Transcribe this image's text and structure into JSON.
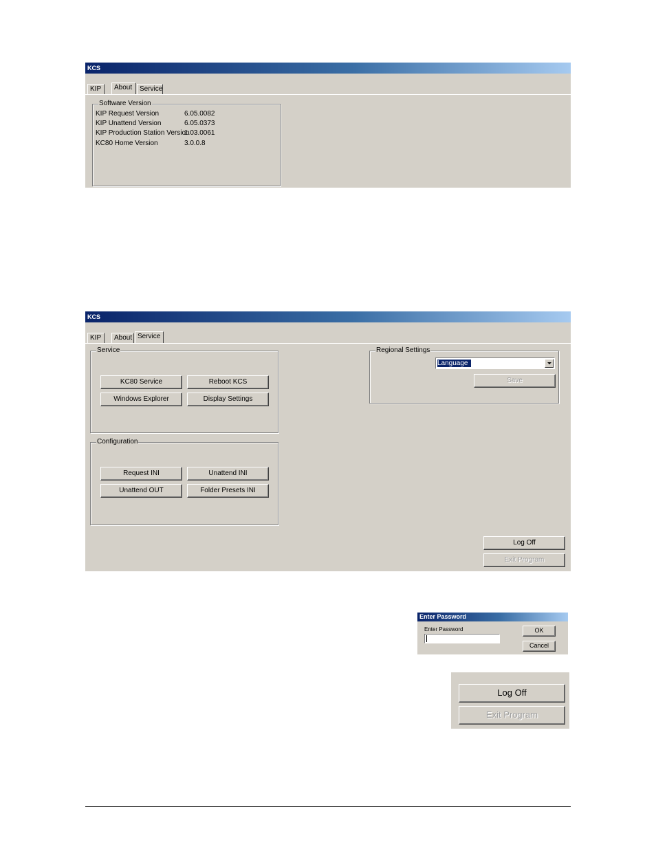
{
  "about_window": {
    "title": "KCS",
    "tabs": [
      {
        "label": "KIP"
      },
      {
        "label": "About"
      },
      {
        "label": "Service"
      }
    ],
    "active_tab": "About",
    "software_version": {
      "legend": "Software Version",
      "rows": [
        {
          "label": "KIP Request Version",
          "value": "6.05.0082"
        },
        {
          "label": "KIP Unattend Version",
          "value": "6.05.0373"
        },
        {
          "label": "KIP Production Station Version",
          "value": "1.03.0061"
        },
        {
          "label": "KC80 Home Version",
          "value": "3.0.0.8"
        }
      ]
    }
  },
  "service_window": {
    "title": "KCS",
    "tabs": [
      {
        "label": "KIP"
      },
      {
        "label": "About"
      },
      {
        "label": "Service"
      }
    ],
    "active_tab": "Service",
    "service_group": {
      "legend": "Service",
      "buttons": {
        "kc80_service": "KC80 Service",
        "reboot_kcs": "Reboot KCS",
        "windows_explorer": "Windows Explorer",
        "display_settings": "Display Settings"
      }
    },
    "configuration_group": {
      "legend": "Configuration",
      "buttons": {
        "request_ini": "Request INI",
        "unattend_ini": "Unattend INI",
        "unattend_out": "Unattend OUT",
        "folder_presets_ini": "Folder Presets INI"
      }
    },
    "regional_settings": {
      "legend": "Regional Settings",
      "language_selected": "Language",
      "save_label": "Save",
      "save_enabled": false
    },
    "log_off_label": "Log Off",
    "exit_program_label": "Exit Program",
    "exit_program_enabled": false
  },
  "password_dialog": {
    "title": "Enter Password",
    "prompt": "Enter Password",
    "password_value": "",
    "ok_label": "OK",
    "cancel_label": "Cancel"
  },
  "zoom_panel": {
    "log_off_label": "Log Off",
    "exit_program_label": "Exit Program",
    "exit_program_enabled": false
  }
}
